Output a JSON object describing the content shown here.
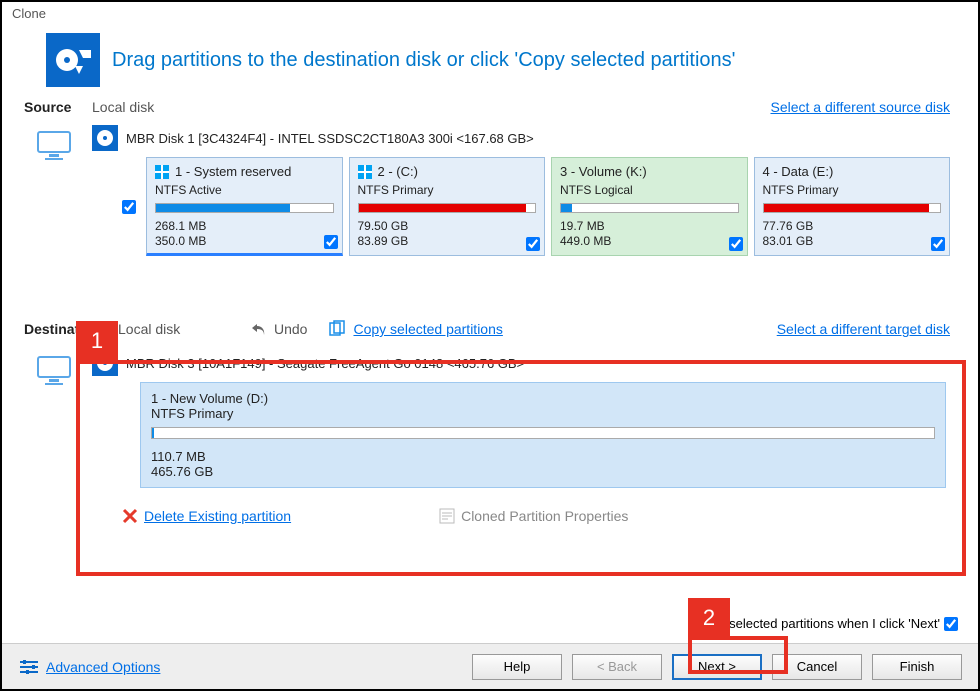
{
  "window_title": "Clone",
  "headline": "Drag partitions to the destination disk or click 'Copy selected partitions'",
  "source": {
    "label": "Source",
    "sub": "Local disk",
    "change_link": "Select a different source disk",
    "disk_label": "MBR Disk 1 [3C4324F4] - INTEL SSDSC2CT180A3 300i  <167.68 GB>",
    "parts": [
      {
        "title": "1 -  System reserved",
        "fs": "NTFS Active",
        "used": "268.1 MB",
        "total": "350.0 MB",
        "color": "#0e8be6",
        "fill": 76
      },
      {
        "title": "2 -   (C:)",
        "fs": "NTFS Primary",
        "used": "79.50 GB",
        "total": "83.89 GB",
        "color": "#e40000",
        "fill": 95
      },
      {
        "title": "3 - Volume (K:)",
        "fs": "NTFS Logical",
        "used": "19.7 MB",
        "total": "449.0 MB",
        "color": "#0e8be6",
        "fill": 6
      },
      {
        "title": "4 - Data   (E:)",
        "fs": "NTFS Primary",
        "used": "77.76 GB",
        "total": "83.01 GB",
        "color": "#e40000",
        "fill": 94
      }
    ]
  },
  "destination": {
    "label": "Destination",
    "sub": "Local disk",
    "undo": "Undo",
    "copy_link": "Copy selected partitions",
    "change_link": "Select a different target disk",
    "disk_label": "MBR Disk 3 [10A1F149] - Seagate  FreeAgent Go     0148  <465.76 GB>",
    "part": {
      "title": "1 - New Volume (D:)",
      "fs": "NTFS Primary",
      "used": "110.7 MB",
      "total": "465.76 GB",
      "fill": 0
    },
    "delete_link": "Delete Existing partition",
    "props_label": "Cloned Partition Properties",
    "auto_copy": "Copy selected partitions when I click 'Next'"
  },
  "callouts": {
    "one": "1",
    "two": "2"
  },
  "footer": {
    "advanced": "Advanced Options",
    "help": "Help",
    "back": "< Back",
    "next": "Next >",
    "cancel": "Cancel",
    "finish": "Finish"
  }
}
